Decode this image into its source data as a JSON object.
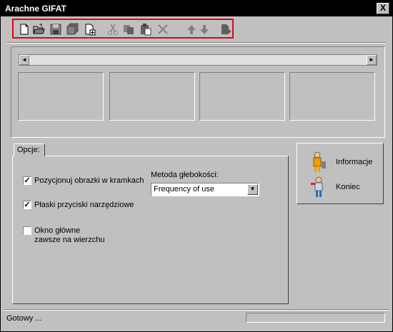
{
  "window": {
    "title": "Arachne GIFAT",
    "close_glyph": "X"
  },
  "toolbar": {
    "highlight_color": "#e2001a",
    "buttons": [
      {
        "name": "new-document-icon"
      },
      {
        "name": "open-folder-icon"
      },
      {
        "name": "save-icon"
      },
      {
        "name": "save-all-icon"
      },
      {
        "name": "add-document-icon"
      },
      {
        "name": "cut-icon"
      },
      {
        "name": "copy-icon"
      },
      {
        "name": "paste-icon"
      },
      {
        "name": "delete-icon"
      },
      {
        "name": "move-up-icon"
      },
      {
        "name": "move-down-icon"
      },
      {
        "name": "export-icon"
      }
    ]
  },
  "scrollbar": {
    "left_arrow": "◄",
    "right_arrow": "►"
  },
  "options": {
    "tab_label": "Opcje:",
    "checkboxes": [
      {
        "label": "Pozycjonuj obrazki w kramkach",
        "checked": true
      },
      {
        "label": "Płaski przyciski narzędziowe",
        "checked": true
      },
      {
        "label_line1": "Okno główne",
        "label_line2": "zawsze na wierzchu",
        "checked": false
      }
    ],
    "check_glyph": "✓",
    "depth_label": "Metoda głebokości:",
    "depth_value": "Frequency of use",
    "dropdown_glyph": "▼"
  },
  "side": {
    "info_label": "Informacje",
    "exit_label": "Koniec"
  },
  "status": {
    "text": "Gotowy ..."
  }
}
